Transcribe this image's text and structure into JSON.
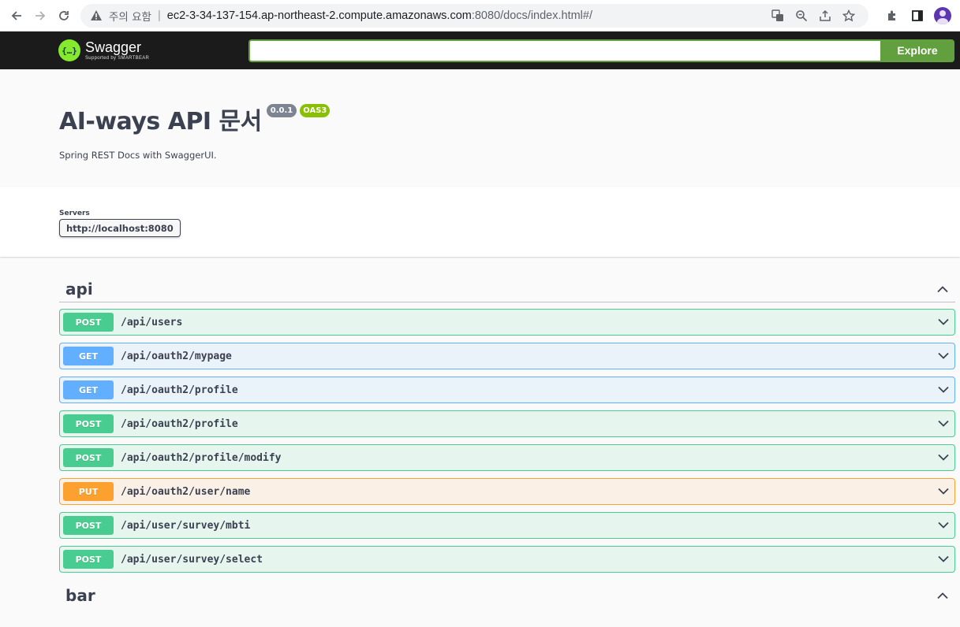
{
  "browser": {
    "security_label": "주의 요함",
    "url_host": "ec2-3-34-137-154.ap-northeast-2.compute.amazonaws.com",
    "url_rest": ":8080/docs/index.html#/"
  },
  "topbar": {
    "logo_name": "Swagger",
    "logo_sub": "Supported by SMARTBEAR",
    "explore_value": "",
    "explore_label": "Explore"
  },
  "info": {
    "title": "AI-ways API 문서",
    "version": "0.0.1",
    "oas": "OAS3",
    "description": "Spring REST Docs with SwaggerUI."
  },
  "servers": {
    "label": "Servers",
    "selected": "http://localhost:8080"
  },
  "tags": [
    {
      "name": "api",
      "operations": [
        {
          "method": "POST",
          "path": "/api/users"
        },
        {
          "method": "GET",
          "path": "/api/oauth2/mypage"
        },
        {
          "method": "GET",
          "path": "/api/oauth2/profile"
        },
        {
          "method": "POST",
          "path": "/api/oauth2/profile"
        },
        {
          "method": "POST",
          "path": "/api/oauth2/profile/modify"
        },
        {
          "method": "PUT",
          "path": "/api/oauth2/user/name"
        },
        {
          "method": "POST",
          "path": "/api/user/survey/mbti"
        },
        {
          "method": "POST",
          "path": "/api/user/survey/select"
        }
      ]
    },
    {
      "name": "bar",
      "operations": []
    }
  ],
  "colors": {
    "post": "#49cc90",
    "get": "#61affe",
    "put": "#fca130",
    "explore": "#62a03f"
  }
}
